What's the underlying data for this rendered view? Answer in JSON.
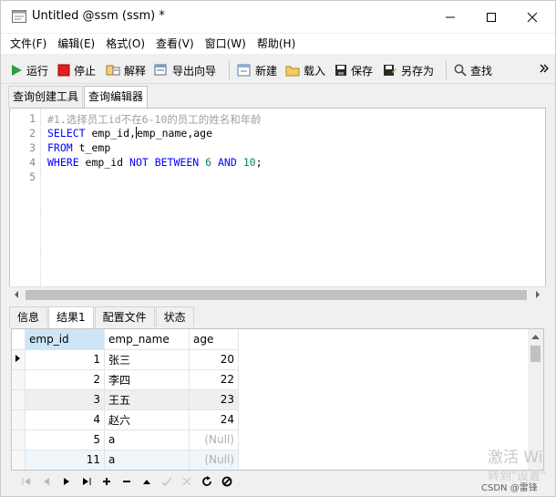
{
  "window": {
    "title": "Untitled @ssm (ssm) *"
  },
  "menu": [
    "文件(F)",
    "编辑(E)",
    "格式(O)",
    "查看(V)",
    "窗口(W)",
    "帮助(H)"
  ],
  "toolbar": {
    "run": "运行",
    "stop": "停止",
    "explain": "解释",
    "export_wizard": "导出向导",
    "new": "新建",
    "load": "载入",
    "save": "保存",
    "save_as": "另存为",
    "find": "查找"
  },
  "query_tabs": [
    "查询创建工具",
    "查询编辑器"
  ],
  "editor": {
    "line_numbers": [
      "1",
      "2",
      "3",
      "4",
      "5"
    ],
    "comment": "#1.选择员工id不在6-10的员工的姓名和年龄",
    "line2_kw": "SELECT",
    "line2_a": " emp_id,",
    "line2_b": "emp_name,age",
    "line3_kw": "FROM",
    "line3_rest": " t_emp",
    "line4_kw1": "WHERE",
    "line4_col": " emp_id ",
    "line4_kw2": "NOT BETWEEN",
    "line4_n1": "6",
    "line4_kw3": "AND",
    "line4_n2": "10",
    "line4_end": ";"
  },
  "result_tabs": [
    "信息",
    "结果1",
    "配置文件",
    "状态"
  ],
  "grid": {
    "columns": [
      "emp_id",
      "emp_name",
      "age"
    ],
    "rows": [
      {
        "emp_id": "1",
        "emp_name": "张三",
        "age": "20"
      },
      {
        "emp_id": "2",
        "emp_name": "李四",
        "age": "22"
      },
      {
        "emp_id": "3",
        "emp_name": "王五",
        "age": "23"
      },
      {
        "emp_id": "4",
        "emp_name": "赵六",
        "age": "24"
      },
      {
        "emp_id": "5",
        "emp_name": "a",
        "age": "(Null)"
      },
      {
        "emp_id": "11",
        "emp_name": "a",
        "age": "(Null)"
      }
    ]
  },
  "watermark": {
    "line1": "激活 Wi",
    "line2": "转到\"设置\""
  },
  "credit": "CSDN @雷锋"
}
